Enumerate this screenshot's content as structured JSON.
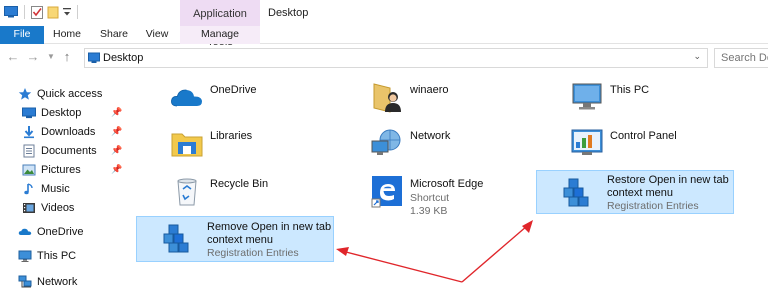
{
  "window": {
    "title": "Desktop"
  },
  "ribbon": {
    "context_header": "Application Tools",
    "tabs": {
      "file": "File",
      "home": "Home",
      "share": "Share",
      "view": "View",
      "manage": "Manage"
    }
  },
  "address": {
    "path": "Desktop",
    "search_placeholder": "Search Desktop"
  },
  "nav": {
    "quick_access": "Quick access",
    "items": [
      {
        "label": "Desktop",
        "pinned": true
      },
      {
        "label": "Downloads",
        "pinned": true
      },
      {
        "label": "Documents",
        "pinned": true
      },
      {
        "label": "Pictures",
        "pinned": true
      },
      {
        "label": "Music",
        "pinned": false
      },
      {
        "label": "Videos",
        "pinned": false
      }
    ],
    "onedrive": "OneDrive",
    "thispc": "This PC",
    "network": "Network"
  },
  "files": {
    "onedrive": {
      "name": "OneDrive"
    },
    "winaero": {
      "name": "winaero"
    },
    "thispc": {
      "name": "This PC"
    },
    "libraries": {
      "name": "Libraries"
    },
    "network": {
      "name": "Network"
    },
    "controlpanel": {
      "name": "Control Panel"
    },
    "recyclebin": {
      "name": "Recycle Bin"
    },
    "edge": {
      "name": "Microsoft Edge",
      "type": "Shortcut",
      "size": "1.39 KB"
    },
    "restore": {
      "name_line1": "Restore Open in new tab",
      "name_line2": "context menu",
      "type": "Registration Entries"
    },
    "remove": {
      "name_line1": "Remove Open in new tab",
      "name_line2": "context menu",
      "type": "Registration Entries"
    }
  },
  "colors": {
    "accent": "#1979ca",
    "selection": "#cce8ff",
    "selection_border": "#99d1ff",
    "annotation": "#e0262b"
  }
}
